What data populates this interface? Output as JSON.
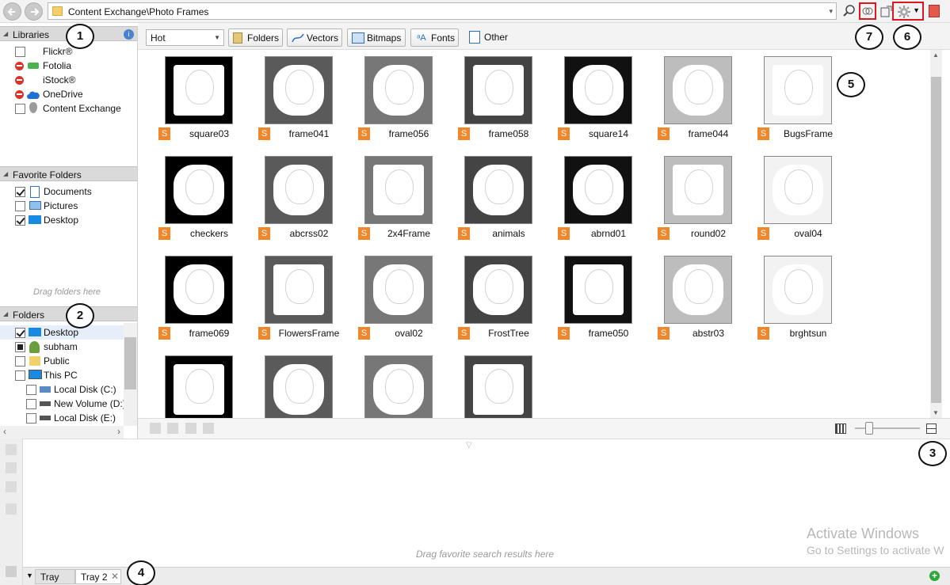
{
  "address": {
    "path": "Content Exchange\\Photo Frames"
  },
  "panes": {
    "libraries": {
      "title": "Libraries",
      "items": [
        "Flickr®",
        "Fotolia",
        "iStock®",
        "OneDrive",
        "Content Exchange"
      ]
    },
    "favorites": {
      "title": "Favorite Folders",
      "items": [
        "Documents",
        "Pictures",
        "Desktop"
      ],
      "hint": "Drag folders here"
    },
    "folders": {
      "title": "Folders",
      "items": [
        "Desktop",
        "subham",
        "Public",
        "This PC",
        "Local Disk (C:)",
        "New Volume (D:)",
        "Local Disk (E:)"
      ]
    }
  },
  "toolbar": {
    "sort": "Hot",
    "filters": [
      "Folders",
      "Vectors",
      "Bitmaps",
      "Fonts",
      "Other"
    ]
  },
  "items": [
    "square03",
    "frame041",
    "frame056",
    "frame058",
    "square14",
    "frame044",
    "BugsFrame",
    "checkers",
    "abcrss02",
    "2x4Frame",
    "animals",
    "abrnd01",
    "round02",
    "oval04",
    "frame069",
    "FlowersFrame",
    "oval02",
    "FrostTree",
    "frame050",
    "abstr03",
    "brghtsun",
    "",
    "",
    "",
    ""
  ],
  "badge": "S",
  "tray": {
    "hint": "Drag favorite search results here",
    "tabs": [
      "Tray",
      "Tray 2"
    ]
  },
  "callouts": [
    "1",
    "2",
    "3",
    "4",
    "5",
    "6",
    "7"
  ],
  "watermark": {
    "line1": "Activate Windows",
    "line2": "Go to Settings to activate W"
  }
}
